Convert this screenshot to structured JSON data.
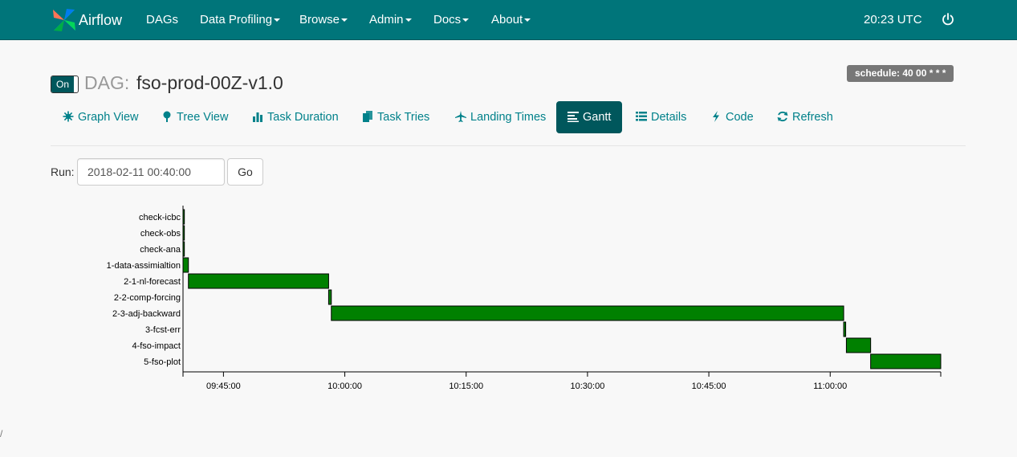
{
  "navbar": {
    "brand": "Airflow",
    "items": [
      {
        "label": "DAGs",
        "dropdown": false
      },
      {
        "label": "Data Profiling",
        "dropdown": true
      },
      {
        "label": "Browse",
        "dropdown": true
      },
      {
        "label": "Admin",
        "dropdown": true
      },
      {
        "label": "Docs",
        "dropdown": true
      },
      {
        "label": "About",
        "dropdown": true
      }
    ],
    "clock": "20:23 UTC",
    "power_icon": "power-icon"
  },
  "dag": {
    "toggle_label": "On",
    "prefix": "DAG:",
    "name": "fso-prod-00Z-v1.0",
    "schedule": "schedule: 40 00 * * *"
  },
  "tabs": [
    {
      "label": "Graph View",
      "icon": "graph-icon"
    },
    {
      "label": "Tree View",
      "icon": "tree-icon"
    },
    {
      "label": "Task Duration",
      "icon": "bar-chart-icon"
    },
    {
      "label": "Task Tries",
      "icon": "duplicate-icon"
    },
    {
      "label": "Landing Times",
      "icon": "plane-icon"
    },
    {
      "label": "Gantt",
      "icon": "align-left-icon",
      "active": true
    },
    {
      "label": "Details",
      "icon": "list-icon"
    },
    {
      "label": "Code",
      "icon": "flash-icon"
    },
    {
      "label": "Refresh",
      "icon": "refresh-icon"
    }
  ],
  "run": {
    "label": "Run:",
    "value": "2018-02-11 00:40:00",
    "go_label": "Go"
  },
  "colors": {
    "navbar": "#00757a",
    "accent": "#00818a",
    "active_tab": "#00575c",
    "bar": "#008000",
    "badge": "#777777"
  },
  "chart_data": {
    "type": "gantt",
    "tasks": [
      {
        "name": "check-icbc",
        "start": "09:40:00",
        "end": "09:40:10"
      },
      {
        "name": "check-obs",
        "start": "09:40:00",
        "end": "09:40:10"
      },
      {
        "name": "check-ana",
        "start": "09:40:00",
        "end": "09:40:10"
      },
      {
        "name": "1-data-assimialtion",
        "start": "09:40:00",
        "end": "09:40:40"
      },
      {
        "name": "2-1-nl-forecast",
        "start": "09:40:40",
        "end": "09:58:00"
      },
      {
        "name": "2-2-comp-forcing",
        "start": "09:58:00",
        "end": "09:58:20"
      },
      {
        "name": "2-3-adj-backward",
        "start": "09:58:20",
        "end": "11:01:40"
      },
      {
        "name": "3-fcst-err",
        "start": "11:01:40",
        "end": "11:01:55"
      },
      {
        "name": "4-fso-impact",
        "start": "11:02:00",
        "end": "11:05:00"
      },
      {
        "name": "5-fso-plot",
        "start": "11:05:00",
        "end": "11:13:40"
      }
    ],
    "x_ticks": [
      "09:45:00",
      "10:00:00",
      "10:15:00",
      "10:30:00",
      "10:45:00",
      "11:00:00"
    ],
    "x_range": [
      "09:40:00",
      "11:13:40"
    ]
  },
  "footer": {
    "mark": "/"
  }
}
